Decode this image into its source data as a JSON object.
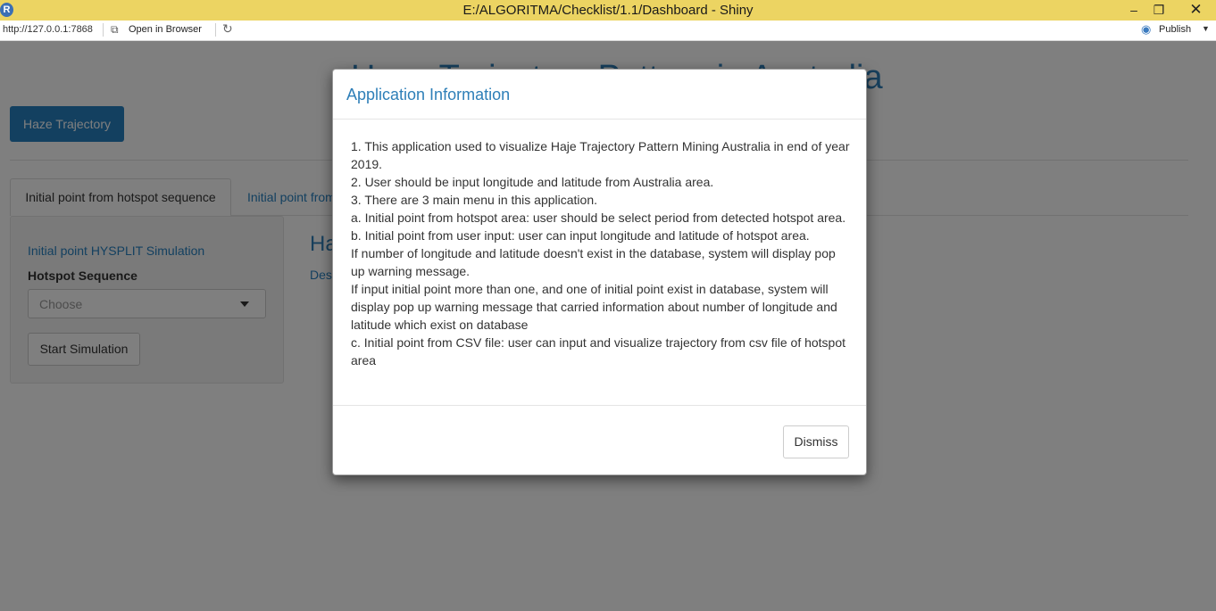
{
  "window": {
    "title": "E:/ALGORITMA/Checklist/1.1/Dashboard - Shiny",
    "app_icon_letter": "R",
    "minimize_icon": "minimize-icon",
    "maximize_icon": "restore-icon",
    "close_icon": "close-icon"
  },
  "toolbar": {
    "url": "http://127.0.0.1:7868",
    "open_in_browser": "Open in Browser",
    "publish": "Publish"
  },
  "app": {
    "title": "Haze Trajectory Pattern in Australia",
    "nav_button": "Haze Trajectory",
    "tabs": [
      {
        "label": "Initial point from hotspot sequence",
        "active": true
      },
      {
        "label": "Initial point from",
        "active": false
      }
    ],
    "sidebar": {
      "title": "Initial point HYSPLIT Simulation",
      "select_label": "Hotspot Sequence",
      "select_placeholder": "Choose",
      "start_button": "Start Simulation"
    },
    "main": {
      "heading": "Ha",
      "description": "Des"
    }
  },
  "modal": {
    "title": "Application Information",
    "lines": [
      "1. This application used to visualize Haje Trajectory Pattern Mining Australia in end of year 2019.",
      "2. User should be input longitude and latitude from Australia area.",
      "3. There are 3 main menu in this application.",
      "a. Initial point from hotspot area: user should be select period from detected hotspot area.",
      "b. Initial point from user input: user can input longitude and latitude of hotspot area.",
      "If number of longitude and latitude doesn't exist in the database, system will display pop up warning message.",
      "If input initial point more than one, and one of initial point exist in database, system will display pop up warning message that carried information about number of longitude and latitude which exist on database",
      "c. Initial point from CSV file: user can input and visualize trajectory from csv file of hotspot area"
    ],
    "dismiss": "Dismiss"
  },
  "colors": {
    "titlebar": "#ecd462",
    "primary": "#2780c0",
    "overlay": "rgba(0,0,0,0.5)"
  }
}
